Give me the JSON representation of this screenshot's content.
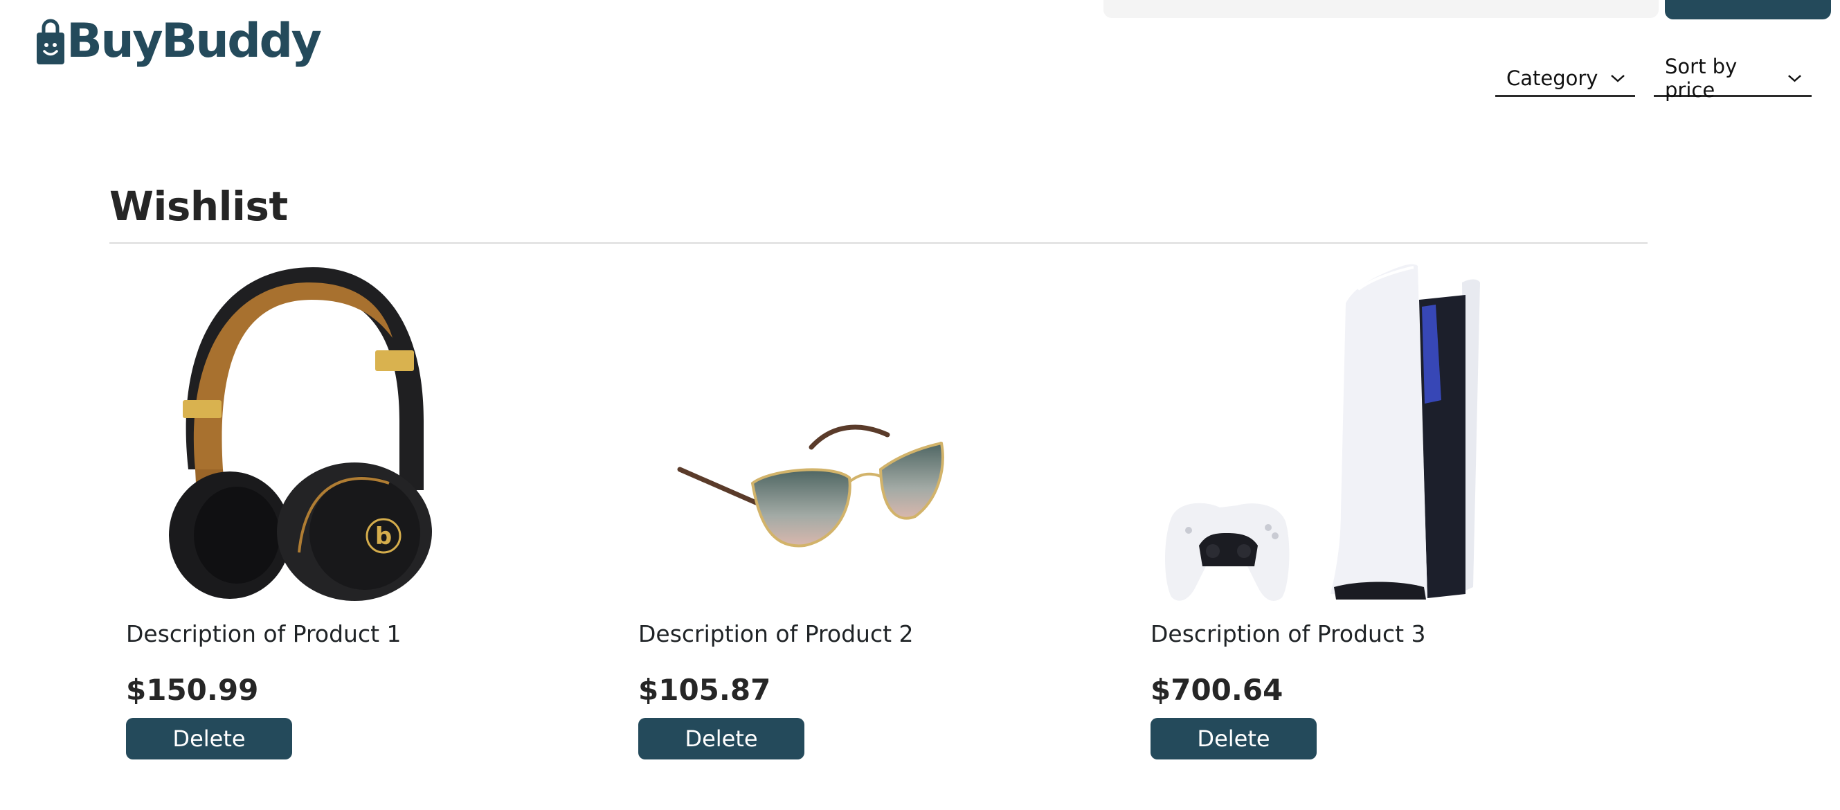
{
  "header": {
    "logo_text": "BuyBuddy",
    "brand_color": "#244a5b",
    "search": {
      "placeholder": "",
      "value": ""
    },
    "filters": [
      {
        "label": "Category",
        "icon": "chevron-down-icon"
      },
      {
        "label": "Sort by price",
        "icon": "chevron-down-icon"
      }
    ]
  },
  "wishlist": {
    "title": "Wishlist",
    "items": [
      {
        "description": "Description of Product 1",
        "price": "$150.99",
        "delete_label": "Delete",
        "image": "headphones-image"
      },
      {
        "description": "Description of Product 2",
        "price": "$105.87",
        "delete_label": "Delete",
        "image": "sunglasses-image"
      },
      {
        "description": "Description of Product 3",
        "price": "$700.64",
        "delete_label": "Delete",
        "image": "game-console-image"
      }
    ]
  }
}
